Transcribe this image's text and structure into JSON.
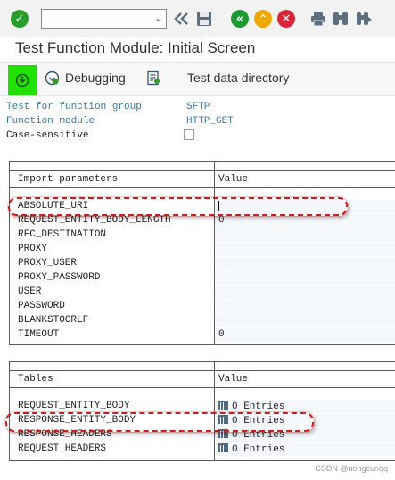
{
  "toolbar": {
    "command_field_value": "",
    "icons": [
      "enter-check-icon",
      "command-dropdown-icon",
      "back-double-chevron-icon",
      "save-icon",
      "back-green-icon",
      "exit-yellow-icon",
      "cancel-red-icon",
      "print-icon",
      "find-icon",
      "find-next-icon"
    ],
    "colors": {
      "enter": "#2a9d2a",
      "back": "#1d9a2f",
      "exit": "#f0a800",
      "cancel": "#d9263b"
    }
  },
  "window": {
    "title": "Test Function Module: Initial Screen"
  },
  "app_toolbar": {
    "execute_icon": "execute-icon",
    "debugging_label": "Debugging",
    "test_data_label": "Test data directory",
    "execute_highlight_color": "#22e000"
  },
  "header": {
    "fields": [
      {
        "label": "Test for function group",
        "value": "SFTP"
      },
      {
        "label": "Function module",
        "value": "HTTP_GET"
      },
      {
        "label": "Case-sensitive",
        "value": ""
      }
    ]
  },
  "import_table": {
    "col1": "Import parameters",
    "col2": "Value",
    "rows": [
      {
        "name": "ABSOLUTE_URI",
        "value": ""
      },
      {
        "name": "REQUEST_ENTITY_BODY_LENGTH",
        "value": "0"
      },
      {
        "name": "RFC_DESTINATION",
        "value": ""
      },
      {
        "name": "PROXY",
        "value": ""
      },
      {
        "name": "PROXY_USER",
        "value": ""
      },
      {
        "name": "PROXY_PASSWORD",
        "value": ""
      },
      {
        "name": "USER",
        "value": ""
      },
      {
        "name": "PASSWORD",
        "value": ""
      },
      {
        "name": "BLANKSTOCRLF",
        "value": ""
      },
      {
        "name": "TIMEOUT",
        "value": "0"
      }
    ]
  },
  "tables_table": {
    "col1": "Tables",
    "col2": "Value",
    "rows": [
      {
        "name": "REQUEST_ENTITY_BODY",
        "value": "0 Entries"
      },
      {
        "name": "RESPONSE_ENTITY_BODY",
        "value": "0 Entries"
      },
      {
        "name": "RESPONSE_HEADERS",
        "value": "0 Entries"
      },
      {
        "name": "REQUEST_HEADERS",
        "value": "0 Entries"
      }
    ]
  },
  "watermark": "CSDN @nongcunqq",
  "annotation_color": "#c81e1e"
}
